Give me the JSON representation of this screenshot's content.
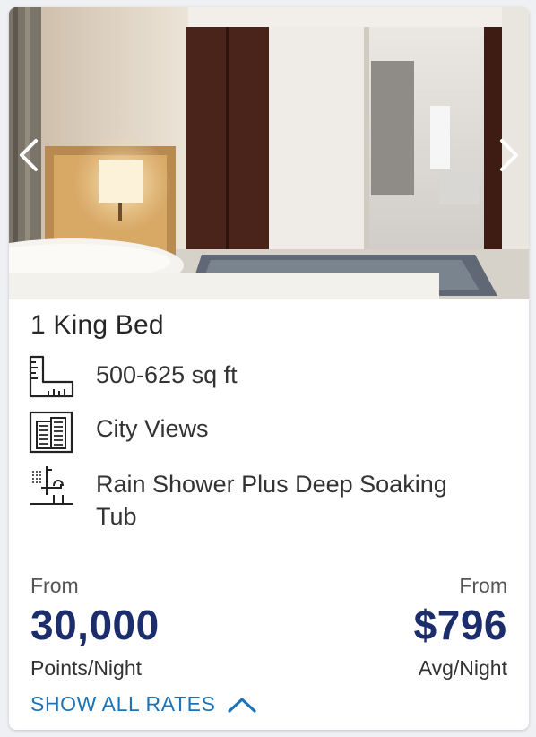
{
  "room": {
    "title": "1 King Bed",
    "features": [
      {
        "icon": "room-size-ruler-icon",
        "text": "500-625 sq ft"
      },
      {
        "icon": "city-view-building-icon",
        "text": "City Views"
      },
      {
        "icon": "rain-shower-icon",
        "text": "Rain Shower Plus Deep Soaking Tub"
      }
    ]
  },
  "photo": {
    "prev_icon": "chevron-left-icon",
    "next_icon": "chevron-right-icon"
  },
  "rates": {
    "points": {
      "from_label": "From",
      "value": "30,000",
      "unit": "Points/Night"
    },
    "cash": {
      "from_label": "From",
      "value": "$796",
      "unit": "Avg/Night"
    },
    "show_all_label": "SHOW ALL RATES",
    "show_all_icon": "chevron-up-icon"
  },
  "colors": {
    "price": "#1c2d6b",
    "link": "#1d73b8",
    "text": "#333333"
  }
}
